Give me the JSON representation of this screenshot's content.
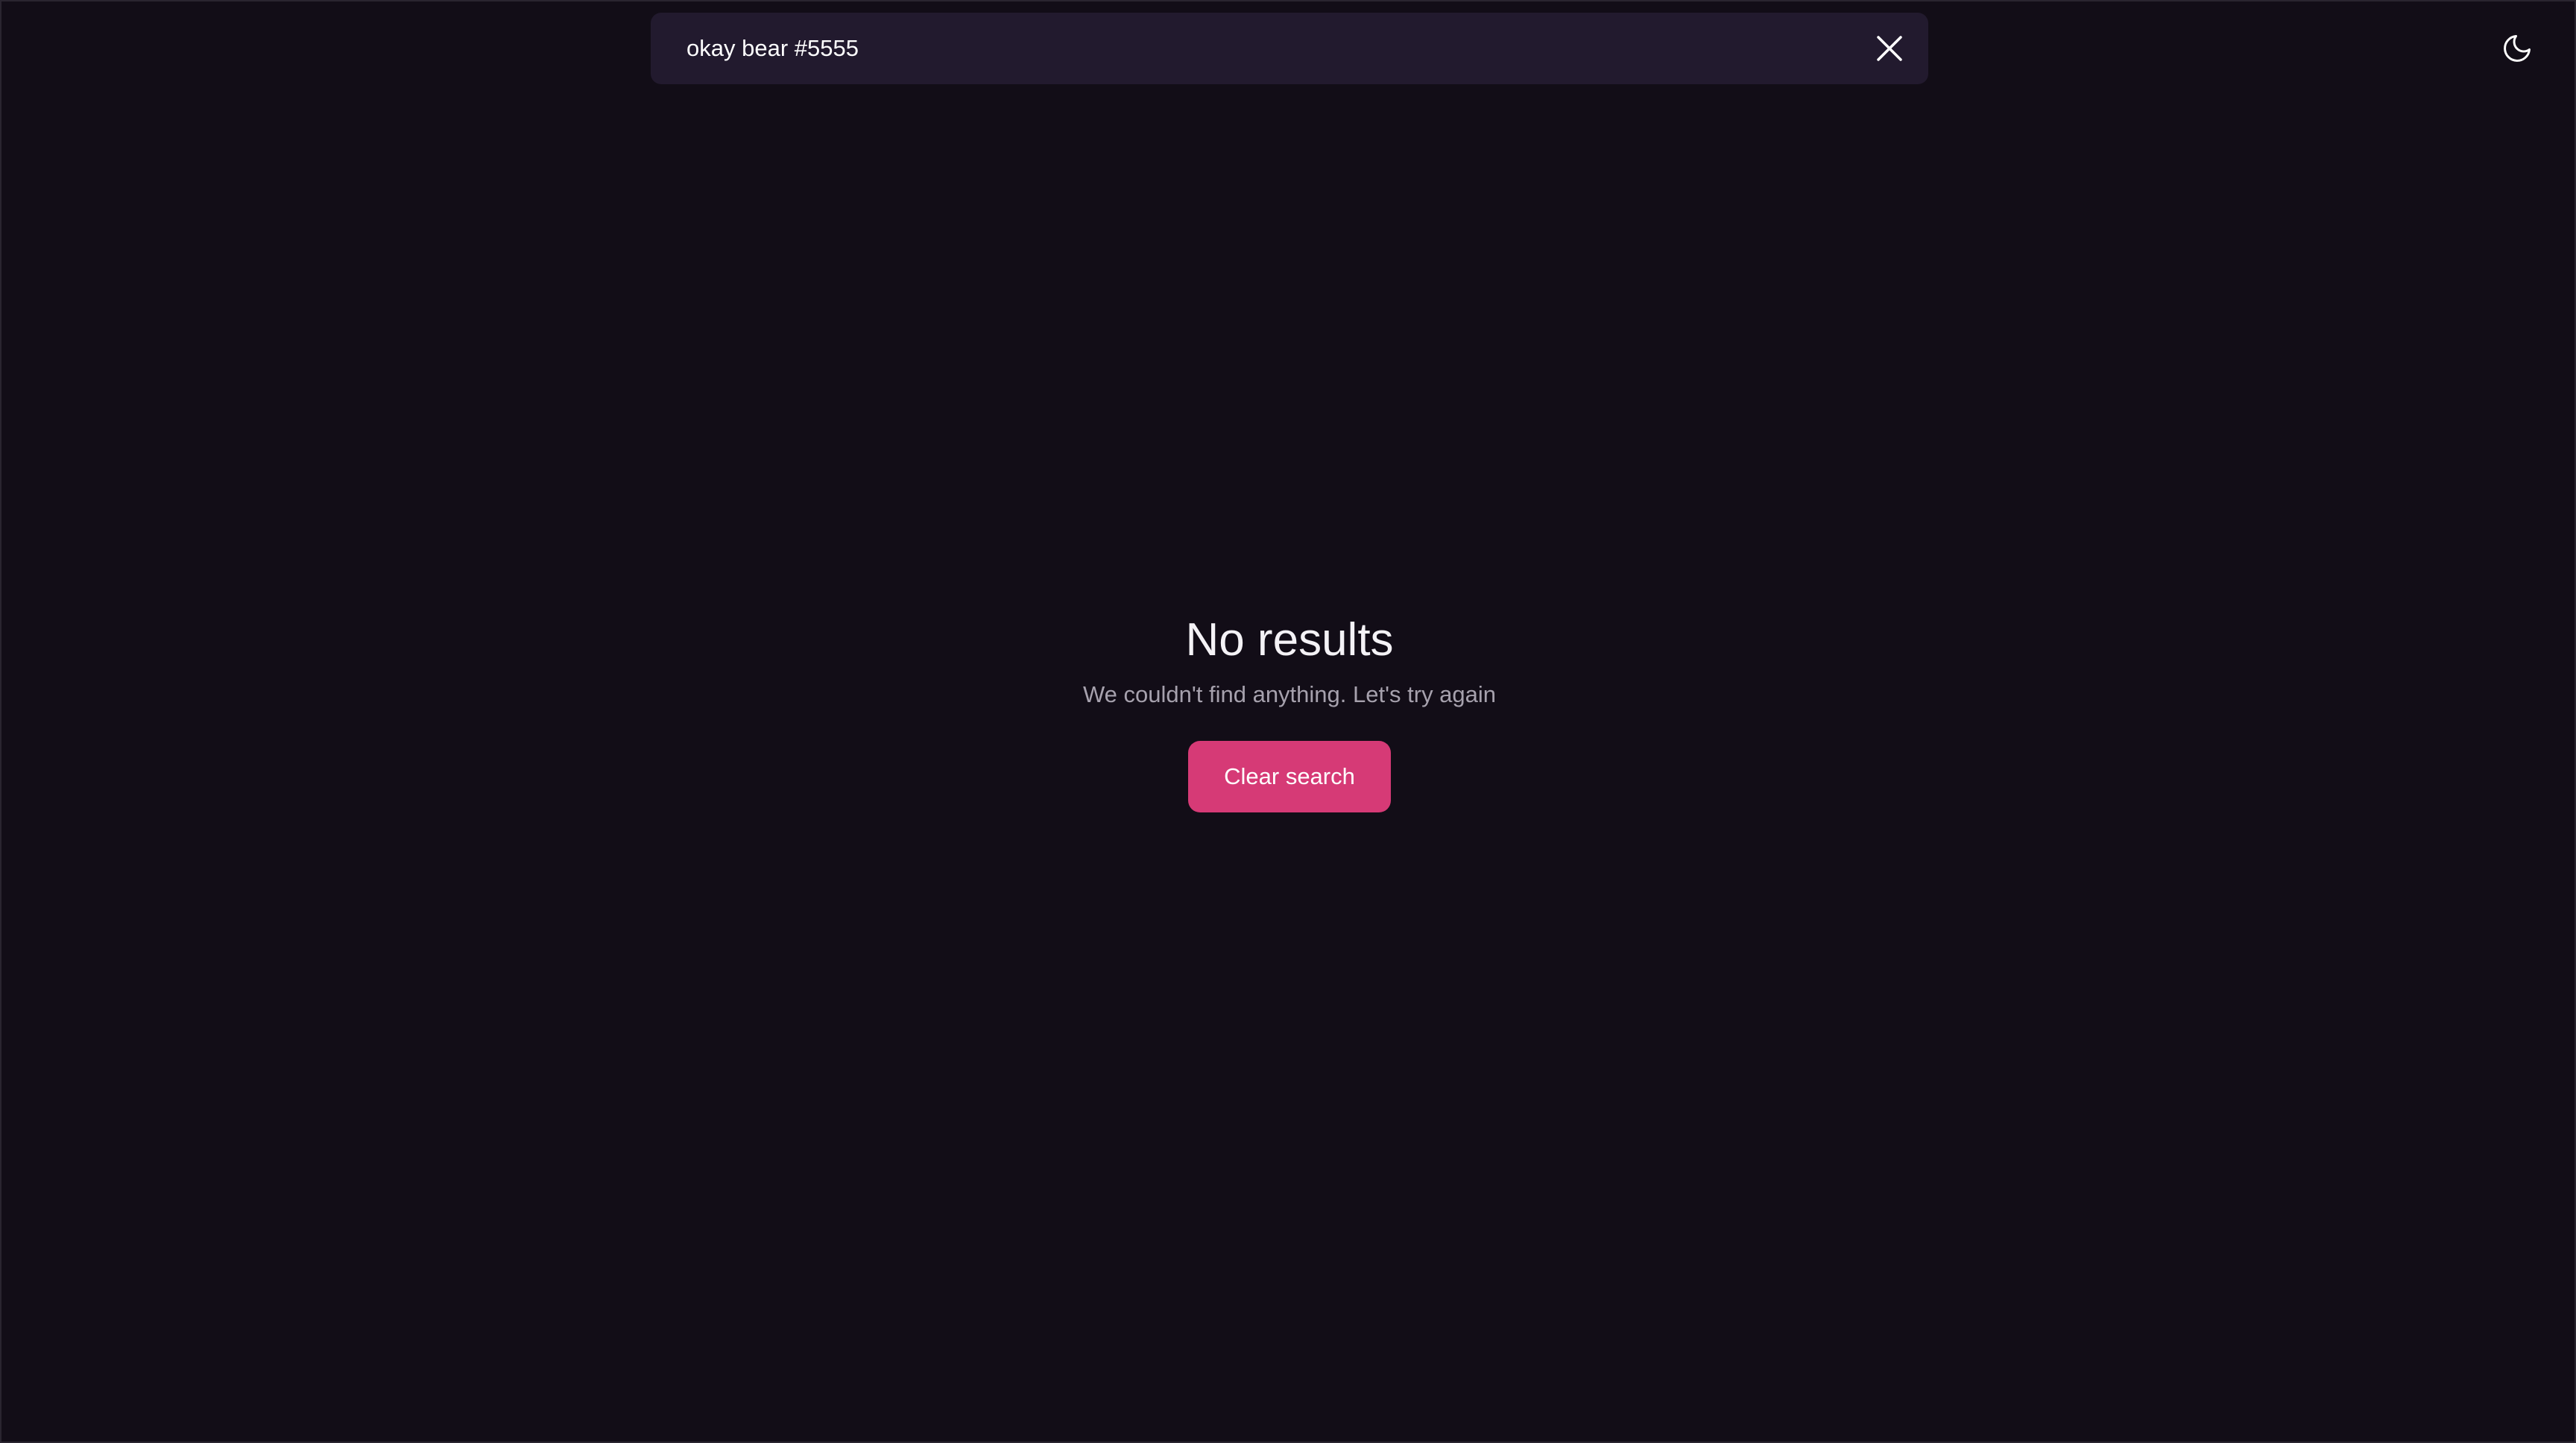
{
  "search": {
    "value": "okay bear #5555",
    "clear_icon": "close-icon"
  },
  "theme_toggle": {
    "icon": "moon-icon"
  },
  "empty_state": {
    "title": "No results",
    "subtitle": "We couldn't find anything. Let's try again",
    "button_label": "Clear search"
  },
  "colors": {
    "background": "#120d17",
    "search_background": "#221a2e",
    "accent": "#d63a76",
    "title_text": "#f4f2f6",
    "muted_text": "#a6a1ad"
  }
}
